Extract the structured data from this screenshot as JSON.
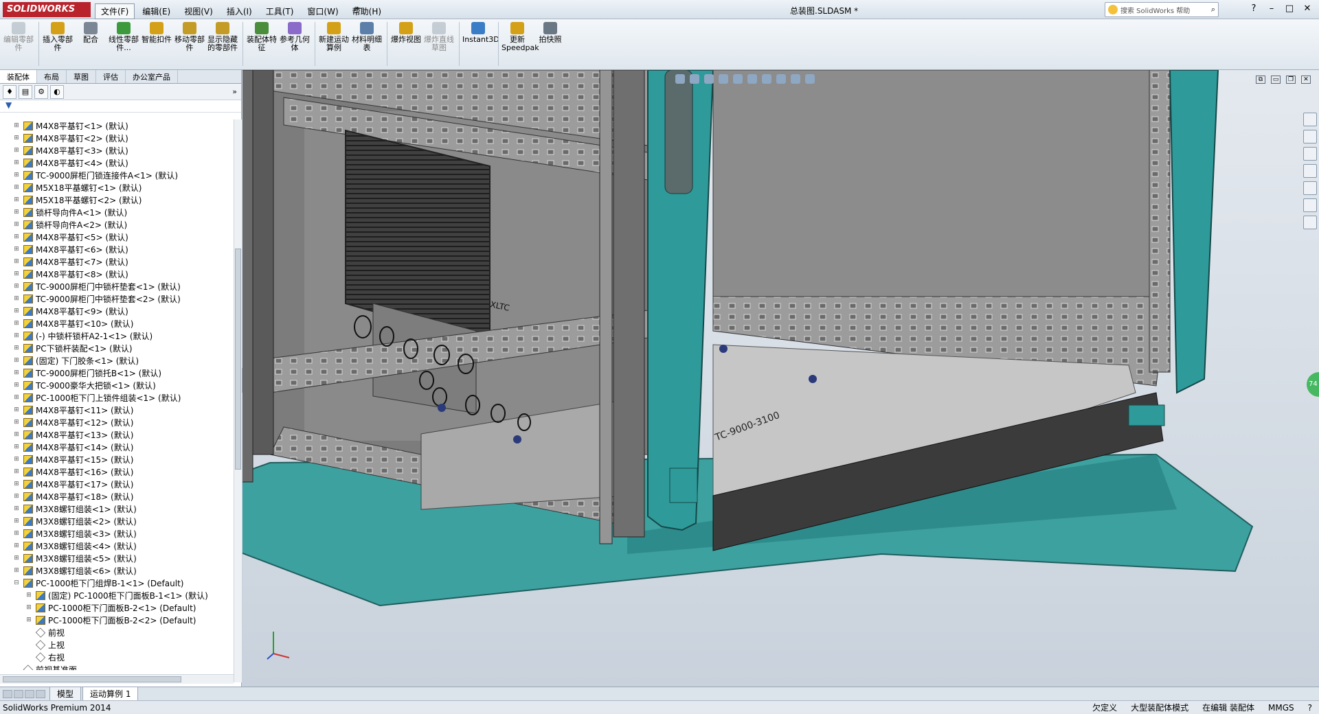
{
  "app": {
    "logo_text": "SOLIDWORKS",
    "document_title": "总装图.SLDASM *"
  },
  "menu": [
    {
      "label": "文件(F)",
      "active": true
    },
    {
      "label": "编辑(E)"
    },
    {
      "label": "视图(V)"
    },
    {
      "label": "插入(I)"
    },
    {
      "label": "工具(T)"
    },
    {
      "label": "窗口(W)"
    },
    {
      "label": "帮助(H)"
    }
  ],
  "help_search": {
    "placeholder": "搜索 SolidWorks 帮助"
  },
  "toolbar": {
    "tools": [
      {
        "label": "编辑零部件",
        "disabled": true,
        "color": "#9aa5b0"
      },
      {
        "label": "插入零部件",
        "color": "#d4a017"
      },
      {
        "label": "配合",
        "color": "#7b8794"
      },
      {
        "label": "线性零部件...",
        "color": "#3c9a3c"
      },
      {
        "label": "智能扣件",
        "color": "#d4a017"
      },
      {
        "label": "移动零部件",
        "color": "#c59b27"
      },
      {
        "label": "显示隐藏的零部件",
        "color": "#c59b27"
      },
      {
        "label": "装配体特征",
        "color": "#4a8d3b"
      },
      {
        "label": "参考几何体",
        "color": "#8a6bc9"
      },
      {
        "label": "新建运动算例",
        "color": "#d4a017"
      },
      {
        "label": "材料明细表",
        "color": "#5b7fa8"
      },
      {
        "label": "爆炸视图",
        "color": "#d4a017"
      },
      {
        "label": "爆炸直线草图",
        "disabled": true,
        "color": "#9aa5b0"
      },
      {
        "label": "Instant3D",
        "color": "#3a7cc6"
      },
      {
        "label": "更新Speedpak",
        "color": "#d4a017"
      },
      {
        "label": "拍快照",
        "color": "#6a7784"
      }
    ]
  },
  "panel": {
    "tabs": [
      {
        "label": "装配体",
        "active": true
      },
      {
        "label": "布局"
      },
      {
        "label": "草图"
      },
      {
        "label": "评估"
      },
      {
        "label": "办公室产品"
      }
    ],
    "filter_icon": "filter-icon"
  },
  "tree": [
    {
      "label": "M4X8平基钉<1> (默认)"
    },
    {
      "label": "M4X8平基钉<2> (默认)"
    },
    {
      "label": "M4X8平基钉<3> (默认)"
    },
    {
      "label": "M4X8平基钉<4> (默认)"
    },
    {
      "label": "TC-9000屏柜门锁连接件A<1> (默认)"
    },
    {
      "label": "M5X18平基螺钉<1> (默认)"
    },
    {
      "label": "M5X18平基螺钉<2> (默认)"
    },
    {
      "label": "锁杆导向件A<1> (默认)"
    },
    {
      "label": "锁杆导向件A<2> (默认)"
    },
    {
      "label": "M4X8平基钉<5> (默认)"
    },
    {
      "label": "M4X8平基钉<6> (默认)"
    },
    {
      "label": "M4X8平基钉<7> (默认)"
    },
    {
      "label": "M4X8平基钉<8> (默认)"
    },
    {
      "label": "TC-9000屏柜门中锁杆垫套<1> (默认)"
    },
    {
      "label": "TC-9000屏柜门中锁杆垫套<2> (默认)"
    },
    {
      "label": "M4X8平基钉<9> (默认)"
    },
    {
      "label": "M4X8平基钉<10> (默认)"
    },
    {
      "label": "(-) 中锁杆锁杆A2-1<1> (默认)"
    },
    {
      "label": "PC下锁杆装配<1> (默认)"
    },
    {
      "label": "(固定) 下门胶条<1> (默认)"
    },
    {
      "label": "TC-9000屏柜门锁托B<1> (默认)"
    },
    {
      "label": "TC-9000豪华大把锁<1> (默认)"
    },
    {
      "label": "PC-1000柜下门上锁件组装<1> (默认)"
    },
    {
      "label": "M4X8平基钉<11> (默认)"
    },
    {
      "label": "M4X8平基钉<12> (默认)"
    },
    {
      "label": "M4X8平基钉<13> (默认)"
    },
    {
      "label": "M4X8平基钉<14> (默认)"
    },
    {
      "label": "M4X8平基钉<15> (默认)"
    },
    {
      "label": "M4X8平基钉<16> (默认)"
    },
    {
      "label": "M4X8平基钉<17> (默认)"
    },
    {
      "label": "M4X8平基钉<18> (默认)"
    },
    {
      "label": "M3X8螺钉组装<1> (默认)"
    },
    {
      "label": "M3X8螺钉组装<2> (默认)"
    },
    {
      "label": "M3X8螺钉组装<3> (默认)"
    },
    {
      "label": "M3X8螺钉组装<4> (默认)"
    },
    {
      "label": "M3X8螺钉组装<5> (默认)"
    },
    {
      "label": "M3X8螺钉组装<6> (默认)"
    },
    {
      "label": "PC-1000柜下门组焊B-1<1> (Default)",
      "expanded": true
    },
    {
      "label": "(固定) PC-1000柜下门面板B-1<1> (默认)",
      "level": 1
    },
    {
      "label": "PC-1000柜下门面板B-2<1> (Default)",
      "level": 1
    },
    {
      "label": "PC-1000柜下门面板B-2<2> (Default)",
      "level": 1
    },
    {
      "label": "前视",
      "level": 1,
      "plane": true
    },
    {
      "label": "上视",
      "level": 1,
      "plane": true
    },
    {
      "label": "右视",
      "level": 1,
      "plane": true
    },
    {
      "label": "前视基准面",
      "plane": true
    }
  ],
  "bottom_tabs": [
    {
      "label": "模型"
    },
    {
      "label": "运动算例 1",
      "active": true
    }
  ],
  "status": {
    "app_version": "SolidWorks Premium 2014",
    "items": [
      "欠定义",
      "大型装配体模式",
      "在编辑 装配体",
      "MMGS",
      "?"
    ]
  },
  "side_badge": "74",
  "colors": {
    "cabinet_teal": "#2f9a9a",
    "frame_grey": "#8e8e8e",
    "viewport_bg": "#d5dde6"
  }
}
